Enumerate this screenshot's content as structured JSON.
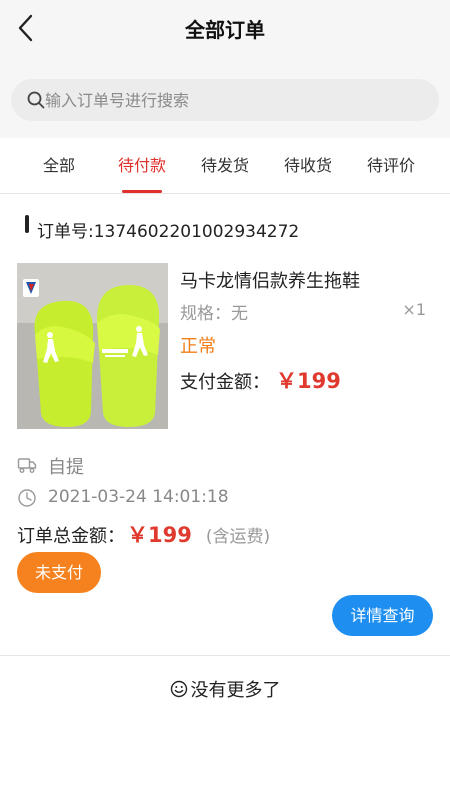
{
  "header": {
    "title": "全部订单"
  },
  "search": {
    "placeholder": "输入订单号进行搜索"
  },
  "tabs": [
    {
      "label": "全部"
    },
    {
      "label": "待付款"
    },
    {
      "label": "待发货"
    },
    {
      "label": "待收货"
    },
    {
      "label": "待评价"
    }
  ],
  "active_tab": "待付款",
  "order": {
    "order_no": "订单号:1374602201002934272",
    "product_name": "马卡龙情侣款养生拖鞋",
    "spec": "规格：无",
    "quantity": "×1",
    "status": "正常",
    "pay_label": "支付金额：",
    "pay_amount": "￥199",
    "delivery_method": "自提",
    "time": "2021-03-24 14:01:18",
    "total_label": "订单总金额：",
    "total_amount": "￥199",
    "shipping_note": "(含运费)",
    "unpaid_label": "未支付",
    "detail_label": "详情查询"
  },
  "footer": {
    "no_more": "没有更多了"
  },
  "colors": {
    "accent_red": "#e0312c",
    "price_red": "#e03a2f",
    "status_orange": "#f07f1a",
    "unpaid_orange": "#f5821f",
    "detail_blue": "#1e8ff0",
    "product_green": "#c8f03a"
  },
  "icons": {
    "back": "chevron-left-icon",
    "search": "search-icon",
    "pickup": "truck-icon",
    "time": "clock-icon",
    "empty": "smile-icon"
  }
}
